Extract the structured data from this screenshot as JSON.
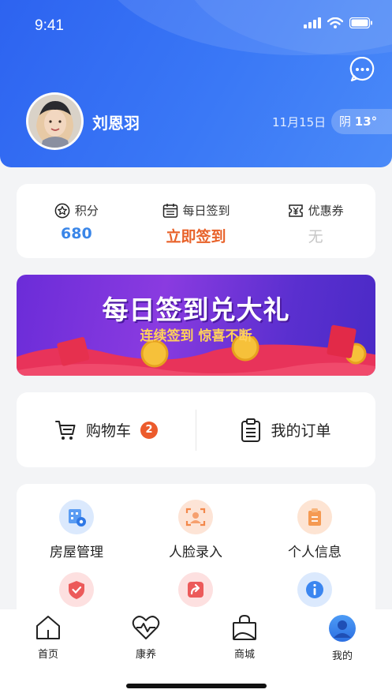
{
  "status_bar": {
    "time": "9:41"
  },
  "header": {
    "username": "刘恩羽",
    "date": "11月15日",
    "weather": "阴",
    "temperature": "13°",
    "chat_icon": "chat-bubble-icon"
  },
  "stats": [
    {
      "icon": "star-icon",
      "label": "积分",
      "value": "680"
    },
    {
      "icon": "calendar-icon",
      "label": "每日签到",
      "value": "立即签到"
    },
    {
      "icon": "coupon-icon",
      "label": "优惠券",
      "value": "无"
    }
  ],
  "banner": {
    "title": "每日签到兑大礼",
    "subtitle": "连续签到 惊喜不断"
  },
  "orders": {
    "cart_label": "购物车",
    "cart_count": "2",
    "orders_label": "我的订单"
  },
  "services": [
    {
      "label": "房屋管理",
      "icon": "house-settings-icon",
      "color": "#3b86f0"
    },
    {
      "label": "人脸录入",
      "icon": "face-scan-icon",
      "color": "#f3884a"
    },
    {
      "label": "个人信息",
      "icon": "id-card-icon",
      "color": "#f59a52"
    },
    {
      "label": "",
      "icon": "shield-icon",
      "color": "#ec5a5a"
    },
    {
      "label": "",
      "icon": "share-icon",
      "color": "#ec5a5a"
    },
    {
      "label": "",
      "icon": "info-icon",
      "color": "#3b86f0"
    }
  ],
  "tabbar": [
    {
      "label": "首页",
      "icon": "home-icon"
    },
    {
      "label": "康养",
      "icon": "heart-pulse-icon"
    },
    {
      "label": "商城",
      "icon": "shopping-bag-icon"
    },
    {
      "label": "我的",
      "icon": "profile-icon",
      "active": true
    }
  ],
  "colors": {
    "header_blue": "#2d63f0",
    "accent_orange": "#e8622a",
    "points_blue": "#3a86e8",
    "badge_red": "#ec5b2c"
  }
}
